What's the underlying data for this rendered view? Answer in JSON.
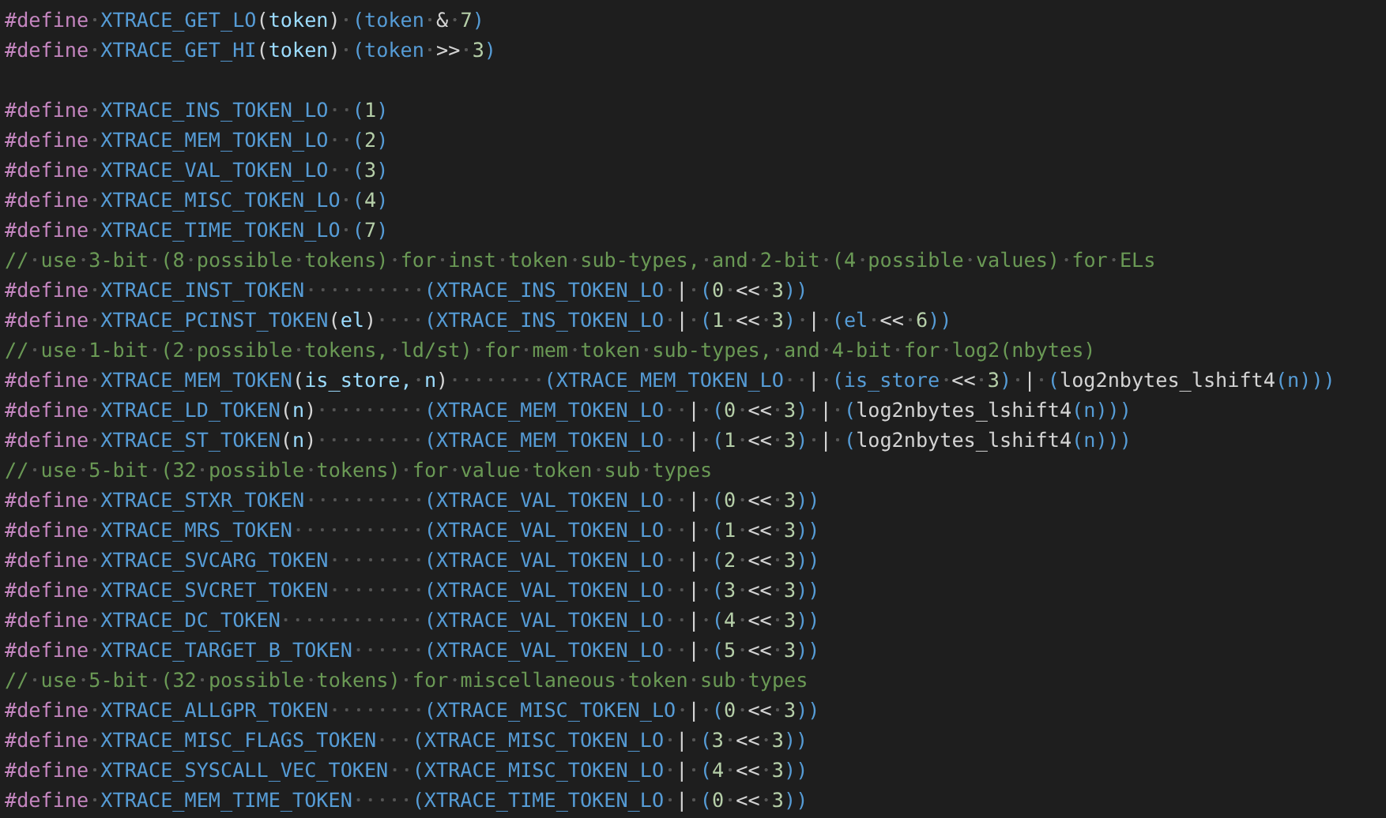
{
  "editor": {
    "lines": [
      {
        "kind": "code",
        "tokens": [
          {
            "kind": "directive",
            "text": "#define"
          },
          {
            "kind": "macro",
            "text": " XTRACE_GET_LO"
          },
          {
            "kind": "punct",
            "text": "("
          },
          {
            "kind": "param",
            "text": "token"
          },
          {
            "kind": "punct",
            "text": ")"
          },
          {
            "kind": "paren",
            "text": " (token"
          },
          {
            "kind": "operator",
            "text": " & "
          },
          {
            "kind": "number",
            "text": "7"
          },
          {
            "kind": "paren",
            "text": ")"
          }
        ]
      },
      {
        "kind": "code",
        "tokens": [
          {
            "kind": "directive",
            "text": "#define"
          },
          {
            "kind": "macro",
            "text": " XTRACE_GET_HI"
          },
          {
            "kind": "punct",
            "text": "("
          },
          {
            "kind": "param",
            "text": "token"
          },
          {
            "kind": "punct",
            "text": ")"
          },
          {
            "kind": "paren",
            "text": " (token"
          },
          {
            "kind": "operator",
            "text": " >> "
          },
          {
            "kind": "number",
            "text": "3"
          },
          {
            "kind": "paren",
            "text": ")"
          }
        ]
      },
      {
        "kind": "blank"
      },
      {
        "kind": "code",
        "tokens": [
          {
            "kind": "directive",
            "text": "#define"
          },
          {
            "kind": "macro",
            "text": " XTRACE_INS_TOKEN_LO  ("
          },
          {
            "kind": "number",
            "text": "1"
          },
          {
            "kind": "paren",
            "text": ")"
          }
        ]
      },
      {
        "kind": "code",
        "tokens": [
          {
            "kind": "directive",
            "text": "#define"
          },
          {
            "kind": "macro",
            "text": " XTRACE_MEM_TOKEN_LO  ("
          },
          {
            "kind": "number",
            "text": "2"
          },
          {
            "kind": "paren",
            "text": ")"
          }
        ]
      },
      {
        "kind": "code",
        "tokens": [
          {
            "kind": "directive",
            "text": "#define"
          },
          {
            "kind": "macro",
            "text": " XTRACE_VAL_TOKEN_LO  ("
          },
          {
            "kind": "number",
            "text": "3"
          },
          {
            "kind": "paren",
            "text": ")"
          }
        ]
      },
      {
        "kind": "code",
        "tokens": [
          {
            "kind": "directive",
            "text": "#define"
          },
          {
            "kind": "macro",
            "text": " XTRACE_MISC_TOKEN_LO ("
          },
          {
            "kind": "number",
            "text": "4"
          },
          {
            "kind": "paren",
            "text": ")"
          }
        ]
      },
      {
        "kind": "code",
        "tokens": [
          {
            "kind": "directive",
            "text": "#define"
          },
          {
            "kind": "macro",
            "text": " XTRACE_TIME_TOKEN_LO ("
          },
          {
            "kind": "number",
            "text": "7"
          },
          {
            "kind": "paren",
            "text": ")"
          }
        ]
      },
      {
        "kind": "code",
        "tokens": [
          {
            "kind": "comment",
            "text": "// use 3-bit (8 possible tokens) for inst token sub-types, and 2-bit (4 possible values) for ELs"
          }
        ]
      },
      {
        "kind": "code",
        "tokens": [
          {
            "kind": "directive",
            "text": "#define"
          },
          {
            "kind": "macro",
            "text": " XTRACE_INST_TOKEN          (XTRACE_INS_TOKEN_LO"
          },
          {
            "kind": "operator",
            "text": " | "
          },
          {
            "kind": "paren",
            "text": "("
          },
          {
            "kind": "number",
            "text": "0"
          },
          {
            "kind": "operator",
            "text": " << "
          },
          {
            "kind": "number",
            "text": "3"
          },
          {
            "kind": "paren",
            "text": "))"
          }
        ]
      },
      {
        "kind": "code",
        "tokens": [
          {
            "kind": "directive",
            "text": "#define"
          },
          {
            "kind": "macro",
            "text": " XTRACE_PCINST_TOKEN"
          },
          {
            "kind": "punct",
            "text": "("
          },
          {
            "kind": "param",
            "text": "el"
          },
          {
            "kind": "punct",
            "text": ")"
          },
          {
            "kind": "paren",
            "text": "    (XTRACE_INS_TOKEN_LO"
          },
          {
            "kind": "operator",
            "text": " | "
          },
          {
            "kind": "paren",
            "text": "("
          },
          {
            "kind": "number",
            "text": "1"
          },
          {
            "kind": "operator",
            "text": " << "
          },
          {
            "kind": "number",
            "text": "3"
          },
          {
            "kind": "paren",
            "text": ")"
          },
          {
            "kind": "operator",
            "text": " | "
          },
          {
            "kind": "paren",
            "text": "(el"
          },
          {
            "kind": "operator",
            "text": " << "
          },
          {
            "kind": "number",
            "text": "6"
          },
          {
            "kind": "paren",
            "text": "))"
          }
        ]
      },
      {
        "kind": "code",
        "tokens": [
          {
            "kind": "comment",
            "text": "// use 1-bit (2 possible tokens, ld/st) for mem token sub-types, and 4-bit for log2(nbytes)"
          }
        ]
      },
      {
        "kind": "code",
        "tokens": [
          {
            "kind": "directive",
            "text": "#define"
          },
          {
            "kind": "macro",
            "text": " XTRACE_MEM_TOKEN"
          },
          {
            "kind": "punct",
            "text": "("
          },
          {
            "kind": "param",
            "text": "is_store, n"
          },
          {
            "kind": "punct",
            "text": ")"
          },
          {
            "kind": "paren",
            "text": "        (XTRACE_MEM_TOKEN_LO"
          },
          {
            "kind": "operator",
            "text": "  | "
          },
          {
            "kind": "paren",
            "text": "(is_store"
          },
          {
            "kind": "operator",
            "text": " << "
          },
          {
            "kind": "number",
            "text": "3"
          },
          {
            "kind": "paren",
            "text": ")"
          },
          {
            "kind": "operator",
            "text": " | "
          },
          {
            "kind": "paren",
            "text": "("
          },
          {
            "kind": "function",
            "text": "log2nbytes_lshift4"
          },
          {
            "kind": "paren",
            "text": "(n)))"
          }
        ]
      },
      {
        "kind": "code",
        "tokens": [
          {
            "kind": "directive",
            "text": "#define"
          },
          {
            "kind": "macro",
            "text": " XTRACE_LD_TOKEN"
          },
          {
            "kind": "punct",
            "text": "("
          },
          {
            "kind": "param",
            "text": "n"
          },
          {
            "kind": "punct",
            "text": ")"
          },
          {
            "kind": "paren",
            "text": "         (XTRACE_MEM_TOKEN_LO"
          },
          {
            "kind": "operator",
            "text": "  | "
          },
          {
            "kind": "paren",
            "text": "("
          },
          {
            "kind": "number",
            "text": "0"
          },
          {
            "kind": "operator",
            "text": " << "
          },
          {
            "kind": "number",
            "text": "3"
          },
          {
            "kind": "paren",
            "text": ")"
          },
          {
            "kind": "operator",
            "text": " | "
          },
          {
            "kind": "paren",
            "text": "("
          },
          {
            "kind": "function",
            "text": "log2nbytes_lshift4"
          },
          {
            "kind": "paren",
            "text": "(n)))"
          }
        ]
      },
      {
        "kind": "code",
        "tokens": [
          {
            "kind": "directive",
            "text": "#define"
          },
          {
            "kind": "macro",
            "text": " XTRACE_ST_TOKEN"
          },
          {
            "kind": "punct",
            "text": "("
          },
          {
            "kind": "param",
            "text": "n"
          },
          {
            "kind": "punct",
            "text": ")"
          },
          {
            "kind": "paren",
            "text": "         (XTRACE_MEM_TOKEN_LO"
          },
          {
            "kind": "operator",
            "text": "  | "
          },
          {
            "kind": "paren",
            "text": "("
          },
          {
            "kind": "number",
            "text": "1"
          },
          {
            "kind": "operator",
            "text": " << "
          },
          {
            "kind": "number",
            "text": "3"
          },
          {
            "kind": "paren",
            "text": ")"
          },
          {
            "kind": "operator",
            "text": " | "
          },
          {
            "kind": "paren",
            "text": "("
          },
          {
            "kind": "function",
            "text": "log2nbytes_lshift4"
          },
          {
            "kind": "paren",
            "text": "(n)))"
          }
        ]
      },
      {
        "kind": "code",
        "tokens": [
          {
            "kind": "comment",
            "text": "// use 5-bit (32 possible tokens) for value token sub types"
          }
        ]
      },
      {
        "kind": "code",
        "tokens": [
          {
            "kind": "directive",
            "text": "#define"
          },
          {
            "kind": "macro",
            "text": " XTRACE_STXR_TOKEN          (XTRACE_VAL_TOKEN_LO"
          },
          {
            "kind": "operator",
            "text": "  | "
          },
          {
            "kind": "paren",
            "text": "("
          },
          {
            "kind": "number",
            "text": "0"
          },
          {
            "kind": "operator",
            "text": " << "
          },
          {
            "kind": "number",
            "text": "3"
          },
          {
            "kind": "paren",
            "text": "))"
          }
        ]
      },
      {
        "kind": "code",
        "tokens": [
          {
            "kind": "directive",
            "text": "#define"
          },
          {
            "kind": "macro",
            "text": " XTRACE_MRS_TOKEN           (XTRACE_VAL_TOKEN_LO"
          },
          {
            "kind": "operator",
            "text": "  | "
          },
          {
            "kind": "paren",
            "text": "("
          },
          {
            "kind": "number",
            "text": "1"
          },
          {
            "kind": "operator",
            "text": " << "
          },
          {
            "kind": "number",
            "text": "3"
          },
          {
            "kind": "paren",
            "text": "))"
          }
        ]
      },
      {
        "kind": "code",
        "tokens": [
          {
            "kind": "directive",
            "text": "#define"
          },
          {
            "kind": "macro",
            "text": " XTRACE_SVCARG_TOKEN        (XTRACE_VAL_TOKEN_LO"
          },
          {
            "kind": "operator",
            "text": "  | "
          },
          {
            "kind": "paren",
            "text": "("
          },
          {
            "kind": "number",
            "text": "2"
          },
          {
            "kind": "operator",
            "text": " << "
          },
          {
            "kind": "number",
            "text": "3"
          },
          {
            "kind": "paren",
            "text": "))"
          }
        ]
      },
      {
        "kind": "code",
        "tokens": [
          {
            "kind": "directive",
            "text": "#define"
          },
          {
            "kind": "macro",
            "text": " XTRACE_SVCRET_TOKEN        (XTRACE_VAL_TOKEN_LO"
          },
          {
            "kind": "operator",
            "text": "  | "
          },
          {
            "kind": "paren",
            "text": "("
          },
          {
            "kind": "number",
            "text": "3"
          },
          {
            "kind": "operator",
            "text": " << "
          },
          {
            "kind": "number",
            "text": "3"
          },
          {
            "kind": "paren",
            "text": "))"
          }
        ]
      },
      {
        "kind": "code",
        "tokens": [
          {
            "kind": "directive",
            "text": "#define"
          },
          {
            "kind": "macro",
            "text": " XTRACE_DC_TOKEN            (XTRACE_VAL_TOKEN_LO"
          },
          {
            "kind": "operator",
            "text": "  | "
          },
          {
            "kind": "paren",
            "text": "("
          },
          {
            "kind": "number",
            "text": "4"
          },
          {
            "kind": "operator",
            "text": " << "
          },
          {
            "kind": "number",
            "text": "3"
          },
          {
            "kind": "paren",
            "text": "))"
          }
        ]
      },
      {
        "kind": "code",
        "tokens": [
          {
            "kind": "directive",
            "text": "#define"
          },
          {
            "kind": "macro",
            "text": " XTRACE_TARGET_B_TOKEN      (XTRACE_VAL_TOKEN_LO"
          },
          {
            "kind": "operator",
            "text": "  | "
          },
          {
            "kind": "paren",
            "text": "("
          },
          {
            "kind": "number",
            "text": "5"
          },
          {
            "kind": "operator",
            "text": " << "
          },
          {
            "kind": "number",
            "text": "3"
          },
          {
            "kind": "paren",
            "text": "))"
          }
        ]
      },
      {
        "kind": "code",
        "tokens": [
          {
            "kind": "comment",
            "text": "// use 5-bit (32 possible tokens) for miscellaneous token sub types"
          }
        ]
      },
      {
        "kind": "code",
        "tokens": [
          {
            "kind": "directive",
            "text": "#define"
          },
          {
            "kind": "macro",
            "text": " XTRACE_ALLGPR_TOKEN        (XTRACE_MISC_TOKEN_LO"
          },
          {
            "kind": "operator",
            "text": " | "
          },
          {
            "kind": "paren",
            "text": "("
          },
          {
            "kind": "number",
            "text": "0"
          },
          {
            "kind": "operator",
            "text": " << "
          },
          {
            "kind": "number",
            "text": "3"
          },
          {
            "kind": "paren",
            "text": "))"
          }
        ]
      },
      {
        "kind": "code",
        "tokens": [
          {
            "kind": "directive",
            "text": "#define"
          },
          {
            "kind": "macro",
            "text": " XTRACE_MISC_FLAGS_TOKEN   (XTRACE_MISC_TOKEN_LO"
          },
          {
            "kind": "operator",
            "text": " | "
          },
          {
            "kind": "paren",
            "text": "("
          },
          {
            "kind": "number",
            "text": "3"
          },
          {
            "kind": "operator",
            "text": " << "
          },
          {
            "kind": "number",
            "text": "3"
          },
          {
            "kind": "paren",
            "text": "))"
          }
        ]
      },
      {
        "kind": "code",
        "tokens": [
          {
            "kind": "directive",
            "text": "#define"
          },
          {
            "kind": "macro",
            "text": " XTRACE_SYSCALL_VEC_TOKEN  (XTRACE_MISC_TOKEN_LO"
          },
          {
            "kind": "operator",
            "text": " | "
          },
          {
            "kind": "paren",
            "text": "("
          },
          {
            "kind": "number",
            "text": "4"
          },
          {
            "kind": "operator",
            "text": " << "
          },
          {
            "kind": "number",
            "text": "3"
          },
          {
            "kind": "paren",
            "text": "))"
          }
        ]
      },
      {
        "kind": "code",
        "tokens": [
          {
            "kind": "directive",
            "text": "#define"
          },
          {
            "kind": "macro",
            "text": " XTRACE_MEM_TIME_TOKEN     (XTRACE_TIME_TOKEN_LO"
          },
          {
            "kind": "operator",
            "text": " | "
          },
          {
            "kind": "paren",
            "text": "("
          },
          {
            "kind": "number",
            "text": "0"
          },
          {
            "kind": "operator",
            "text": " << "
          },
          {
            "kind": "number",
            "text": "3"
          },
          {
            "kind": "paren",
            "text": "))"
          }
        ]
      }
    ]
  }
}
